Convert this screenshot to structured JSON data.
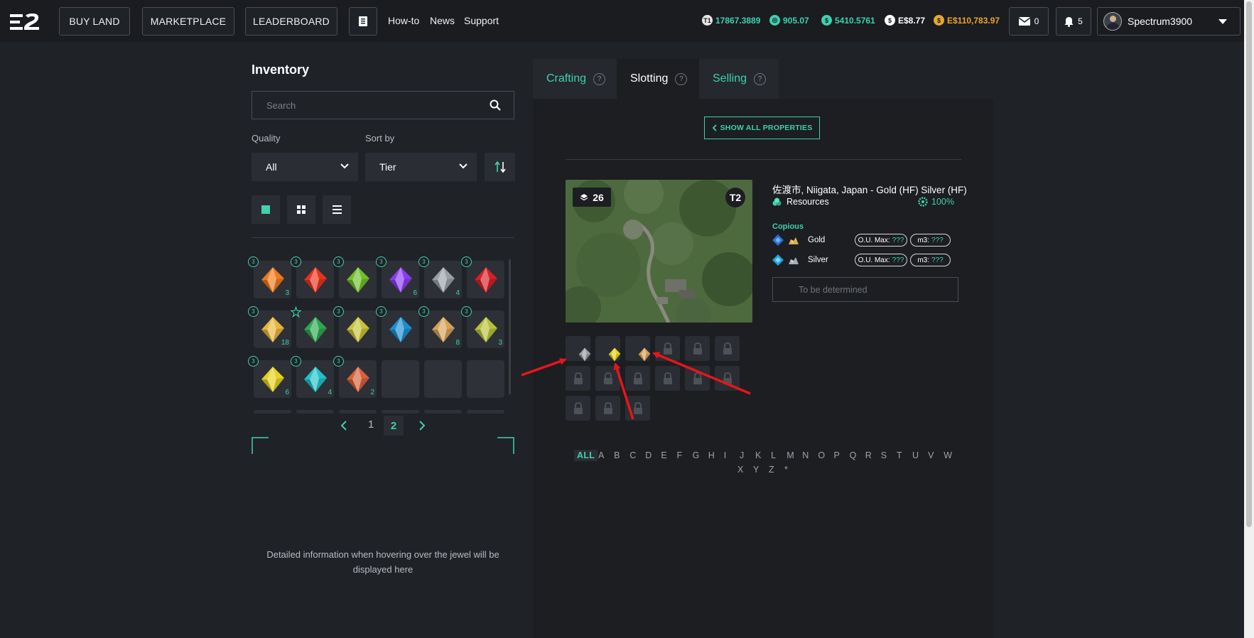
{
  "nav": {
    "buy_land": "BUY LAND",
    "marketplace": "MARKETPLACE",
    "leaderboard": "LEADERBOARD",
    "howto": "How-to",
    "news": "News",
    "support": "Support"
  },
  "balances": [
    {
      "icon": "t1-essence-icon",
      "value": "17867.3889",
      "color": "#3fd1b0"
    },
    {
      "icon": "essence-icon",
      "value": "905.07",
      "color": "#3fd1b0"
    },
    {
      "icon": "ecr-icon",
      "value": "5410.5761",
      "color": "#3fd1b0"
    },
    {
      "icon": "dollar-icon",
      "value": "E$8.77",
      "color": "#ffffff"
    },
    {
      "icon": "gold-coin-icon",
      "value": "E$110,783.97",
      "color": "#e8a530"
    }
  ],
  "mail_count": "0",
  "notif_count": "5",
  "user": {
    "name": "Spectrum3900"
  },
  "inventory": {
    "title": "Inventory",
    "search_placeholder": "Search",
    "quality_label": "Quality",
    "quality_value": "All",
    "sort_label": "Sort by",
    "sort_value": "Tier",
    "gems": [
      {
        "tier": "3",
        "count": "3",
        "color": "#f07a1a"
      },
      {
        "tier": "3",
        "count": "",
        "color": "#e8331c"
      },
      {
        "tier": "3",
        "count": "",
        "color": "#6fbf2a"
      },
      {
        "tier": "3",
        "count": "6",
        "color": "#8a3cf0"
      },
      {
        "tier": "3",
        "count": "4",
        "color": "#9aa0a6"
      },
      {
        "tier": "3",
        "count": "",
        "color": "#d42027"
      },
      {
        "tier": "3",
        "count": "18",
        "color": "#e8b53a"
      },
      {
        "tier": "star",
        "count": "",
        "color": "#2fa84f"
      },
      {
        "tier": "3",
        "count": "",
        "color": "#c8c23a"
      },
      {
        "tier": "3",
        "count": "",
        "color": "#1d8fcf"
      },
      {
        "tier": "3",
        "count": "8",
        "color": "#d6a35a"
      },
      {
        "tier": "3",
        "count": "3",
        "color": "#b7c23a"
      },
      {
        "tier": "3",
        "count": "6",
        "color": "#e6d21e"
      },
      {
        "tier": "3",
        "count": "4",
        "color": "#22c2c8"
      },
      {
        "tier": "3",
        "count": "2",
        "color": "#d8603a"
      }
    ],
    "pages": [
      "1",
      "2"
    ],
    "current_page": "2",
    "hint": "Detailed information when hovering over the jewel will be displayed here"
  },
  "tabs": [
    {
      "label": "Crafting",
      "active": false
    },
    {
      "label": "Slotting",
      "active": true
    },
    {
      "label": "Selling",
      "active": false
    }
  ],
  "slotting": {
    "show_all": "SHOW ALL PROPERTIES",
    "layers": "26",
    "tier": "T2",
    "land_name": "佐渡市, Niigata, Japan - Gold (HF) Silver (HF)",
    "resources_label": "Resources",
    "resources_pct": "100%",
    "copious_label": "Copious",
    "materials": [
      {
        "name": "Gold",
        "ou_label": "O.U. Max:",
        "ou_value": "???",
        "m3_label": "m3:",
        "m3_value": "???"
      },
      {
        "name": "Silver",
        "ou_label": "O.U. Max:",
        "ou_value": "???",
        "m3_label": "m3:",
        "m3_value": "???"
      }
    ],
    "tbd": "To be determined",
    "filled_slots": [
      "#9aa0a6",
      "#e6d21e",
      "#d6a35a"
    ]
  },
  "alphabet_row1": [
    "ALL",
    "A",
    "B",
    "C",
    "D",
    "E",
    "F",
    "G",
    "H",
    "I",
    "J",
    "K",
    "L",
    "M",
    "N",
    "O",
    "P",
    "Q",
    "R",
    "S",
    "T",
    "U",
    "V",
    "W"
  ],
  "alphabet_row2": [
    "X",
    "Y",
    "Z",
    "*"
  ]
}
